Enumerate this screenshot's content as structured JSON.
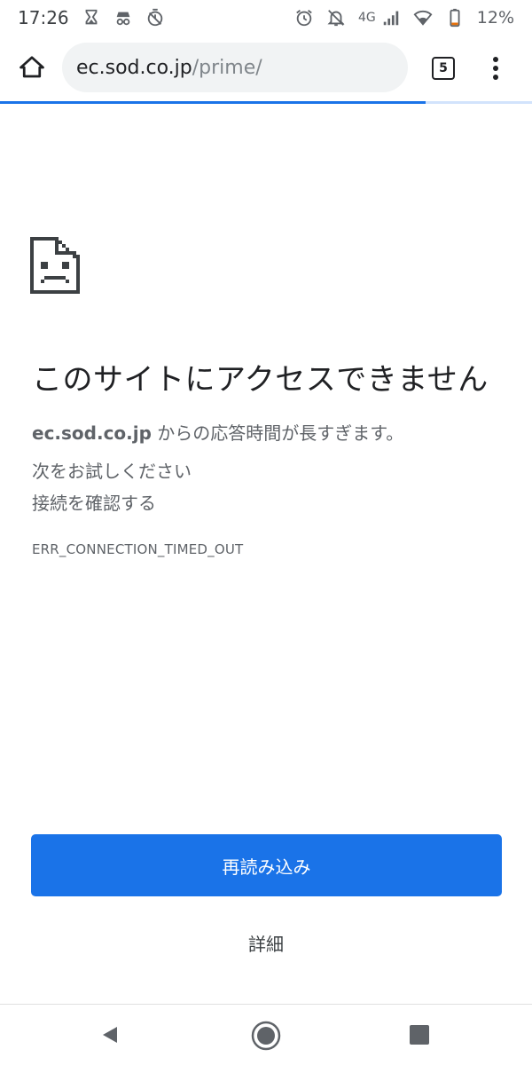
{
  "status_bar": {
    "time": "17:26",
    "network": "4G",
    "battery": "12%",
    "left_icons": [
      "hourglass-icon",
      "incognito-icon",
      "timer-icon"
    ],
    "right_icons": [
      "alarm-icon",
      "notifications-off-icon",
      "signal-icon",
      "wifi-icon",
      "battery-icon"
    ]
  },
  "toolbar": {
    "url_host": "ec.sod.co.jp",
    "url_path": "/prime/",
    "tab_count": "5"
  },
  "progress": {
    "fraction": 0.8
  },
  "error": {
    "title": "このサイトにアクセスできません",
    "host": "ec.sod.co.jp",
    "detail_suffix": " からの応答時間が長すぎます。",
    "suggest_heading": "次をお試しください",
    "suggest_item": "接続を確認する",
    "code": "ERR_CONNECTION_TIMED_OUT"
  },
  "buttons": {
    "reload": "再読み込み",
    "details": "詳細"
  },
  "colors": {
    "accent": "#1a73e8",
    "progress_track": "#d2e3fc",
    "text_primary": "#202124",
    "text_secondary": "#5f6368"
  }
}
